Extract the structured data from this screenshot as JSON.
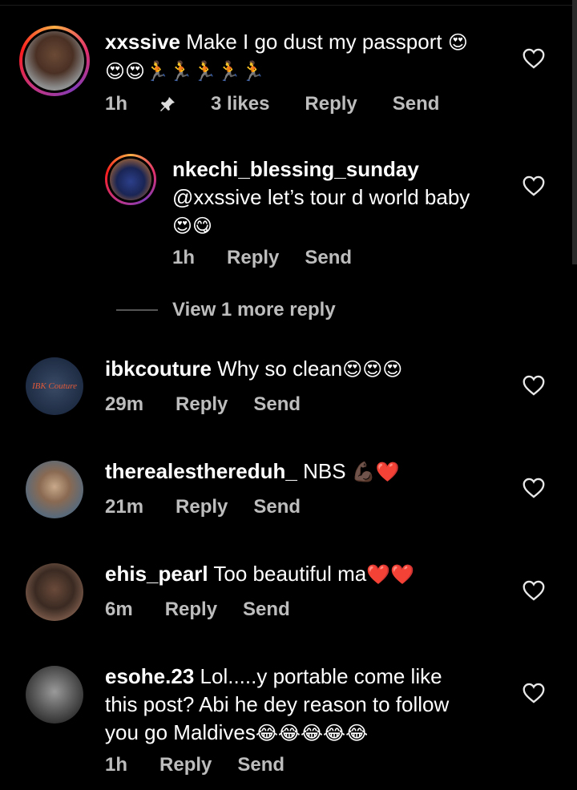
{
  "comments": [
    {
      "username": "xxssive",
      "text": "Make I go dust my passport",
      "emoji_line1": "😍",
      "emoji_line2": "😍😍🏃🏃🏃🏃🏃",
      "time": "1h",
      "pin_icon": "pin-icon",
      "likes": "3 likes",
      "reply": "Reply",
      "send": "Send"
    },
    {
      "username": "nkechi_blessing_sunday",
      "text": "@xxssive let’s tour d world baby",
      "emoji": "😍😋",
      "time": "1h",
      "reply": "Reply",
      "send": "Send"
    },
    {
      "username": "ibkcouture",
      "text": "Why so clean",
      "emoji": "😍😍😍",
      "time": "29m",
      "reply": "Reply",
      "send": "Send",
      "avatar_text": "IBK Couture"
    },
    {
      "username": "therealesthereduh_",
      "text": "NBS",
      "emoji": "💪🏿❤️",
      "time": "21m",
      "reply": "Reply",
      "send": "Send"
    },
    {
      "username": "ehis_pearl",
      "text": "Too beautiful ma",
      "emoji": "❤️❤️",
      "time": "6m",
      "reply": "Reply",
      "send": "Send"
    },
    {
      "username": "esohe.23",
      "line1": "Lol.....y portable come like",
      "line2": "this post? Abi he dey reason to follow",
      "line3": "you go Maldives",
      "emoji": "😂😂😂😂😂",
      "time": "1h",
      "reply": "Reply",
      "send": "Send"
    }
  ],
  "view_more": "View 1 more reply",
  "colors": {
    "background": "#000000",
    "meta": "#bdbdbd",
    "heart": "#e8e8e8"
  }
}
